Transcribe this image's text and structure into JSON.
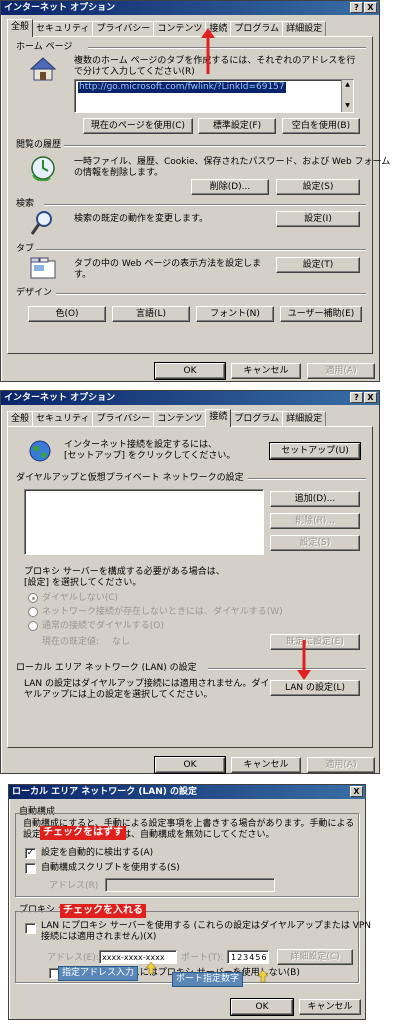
{
  "d1": {
    "title": "インターネット オプション",
    "help": "?",
    "close": "X",
    "tabs": [
      "全般",
      "セキュリティ",
      "プライバシー",
      "コンテンツ",
      "接続",
      "プログラム",
      "詳細設定"
    ],
    "home_group": "ホーム ページ",
    "home_desc": "複数のホーム ページのタブを作成するには、それぞれのアドレスを行で分けて入力してください(R)",
    "home_url": "http://go.microsoft.com/fwlink/?LinkId=69157",
    "btn_current": "現在のページを使用(C)",
    "btn_default": "標準設定(F)",
    "btn_blank": "空白を使用(B)",
    "history_group": "閲覧の履歴",
    "history_desc1": "一時ファイル、履歴、Cookie、保存されたパスワード、および Web フォーム",
    "history_desc2": "の情報を削除します。",
    "btn_delete": "削除(D)...",
    "btn_hist_settings": "設定(S)",
    "search_group": "検索",
    "search_desc": "検索の既定の動作を変更します。",
    "btn_search_settings": "設定(I)",
    "tabs_group": "タブ",
    "tabs_desc1": "タブの中の Web ページの表示方法を設定しま",
    "tabs_desc2": "す。",
    "btn_tabs_settings": "設定(T)",
    "design_group": "デザイン",
    "btn_color": "色(O)",
    "btn_lang": "言語(L)",
    "btn_font": "フォント(N)",
    "btn_access": "ユーザー補助(E)",
    "ok": "OK",
    "cancel": "キャンセル",
    "apply": "適用(A)"
  },
  "d2": {
    "title": "インターネット オプション",
    "help": "?",
    "close": "X",
    "tabs": [
      "全般",
      "セキュリティ",
      "プライバシー",
      "コンテンツ",
      "接続",
      "プログラム",
      "詳細設定"
    ],
    "setup_desc1": "インターネット接続を設定するには、",
    "setup_desc2": "[セットアップ] をクリックしてください。",
    "btn_setup": "セットアップ(U)",
    "dialup_group": "ダイヤルアップと仮想プライベート ネットワークの設定",
    "btn_add": "追加(D)...",
    "btn_remove": "削除(R)...",
    "btn_dial_settings": "設定(S)",
    "proxy_desc1": "プロキシ サーバーを構成する必要がある場合は、",
    "proxy_desc2": "[設定] を選択してください。",
    "radio1": "ダイヤルしない(C)",
    "radio2": "ネットワーク接続が存在しないときには、ダイヤルする(W)",
    "radio3": "通常の接続でダイヤルする(O)",
    "current_default_label": "現在の既定値:",
    "current_default_value": "なし",
    "btn_set_default": "既定に設定(E)",
    "lan_group": "ローカル エリア ネットワーク (LAN) の設定",
    "lan_desc1": "LAN の設定はダイヤルアップ接続には適用されません。ダイ",
    "lan_desc2": "ヤルアップには上の設定を選択してください。",
    "btn_lan": "LAN の設定(L)",
    "ok": "OK",
    "cancel": "キャンセル",
    "apply": "適用(A)"
  },
  "d3": {
    "title": "ローカル エリア ネットワーク (LAN) の設定",
    "close": "X",
    "auto_group": "自動構成",
    "auto_desc1": "自動構成にすると、手動による設定事項を上書きする場合があります。手動による",
    "auto_desc2": "設定を確実に使用するには、自動構成を無効にしてください。",
    "chk_auto_detect": "設定を自動的に検出する(A)",
    "chk_auto_script": "自動構成スクリプトを使用する(S)",
    "address_label": "アドレス(R)",
    "proxy_group": "プロキシ サーバー",
    "chk_proxy": "LAN にプロキシ サーバーを使用する (これらの設定はダイヤルアップまたは VPN",
    "chk_proxy2": "接続には適用されません)(X)",
    "addr_label": "アドレス(E):",
    "addr_value": "xxxx-xxxx-xxxx",
    "port_label": "ポート(T):",
    "port_value": "123456",
    "btn_advanced": "詳細設定(C)",
    "chk_bypass": "ローカル アドレスにはプロキシ サーバーを使用しない(B)",
    "ok": "OK",
    "cancel": "キャンセル"
  },
  "annotations": {
    "uncheck": "チェックをはずす",
    "check": "チェックを入れる",
    "addr_hint": "指定アドレス入力",
    "port_hint": "ポート指定数字"
  },
  "colors": {
    "title_bar": "#0a246a",
    "dialog_face": "#d4d0c8",
    "arrow_red": "#e0201c",
    "label_blue": "#5a86b8"
  }
}
